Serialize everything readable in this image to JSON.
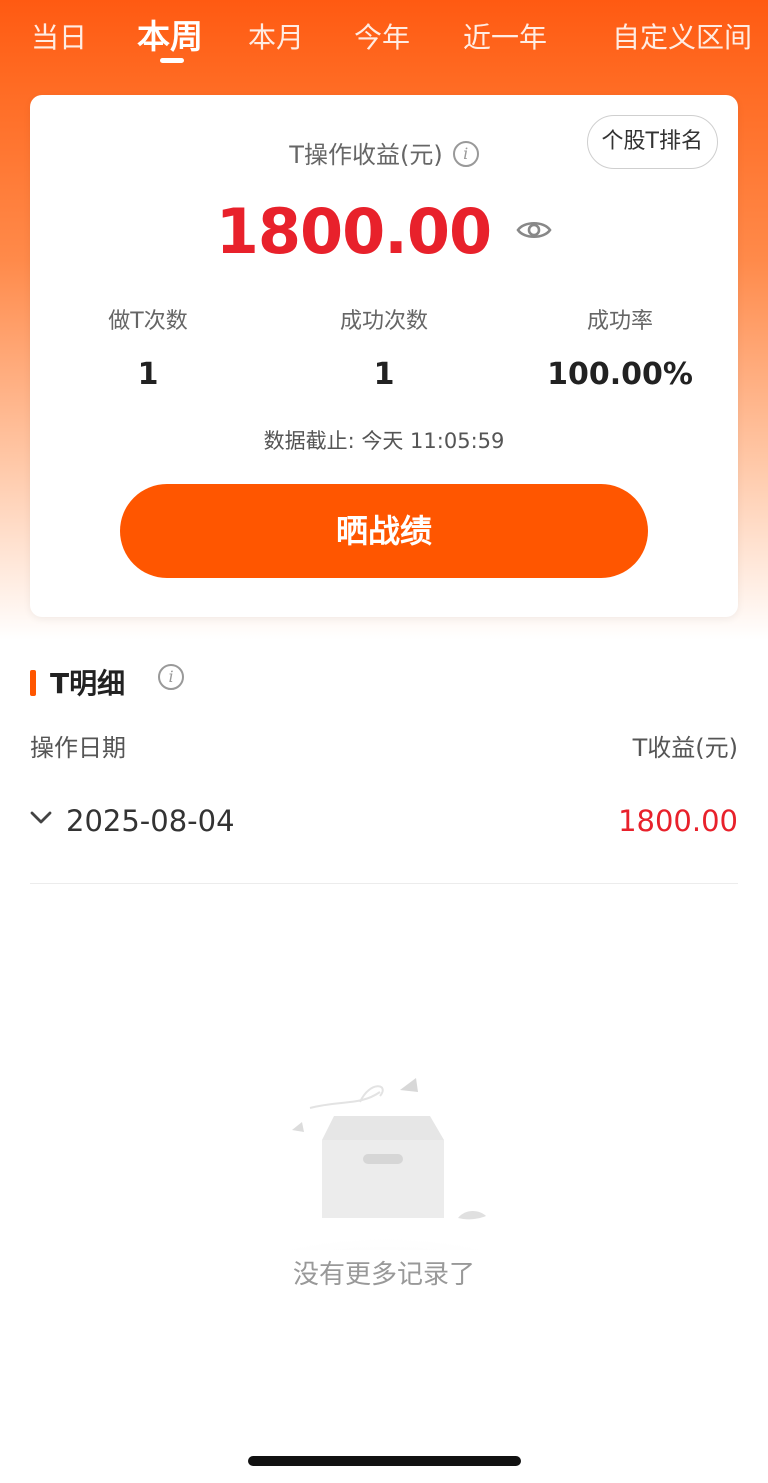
{
  "tabs": [
    {
      "label": "当日"
    },
    {
      "label": "本周"
    },
    {
      "label": "本月"
    },
    {
      "label": "今年"
    },
    {
      "label": "近一年"
    },
    {
      "label": "自定义区间"
    }
  ],
  "active_tab": "本周",
  "summary": {
    "rank_button": "个股T排名",
    "profit_label": "T操作收益(元)",
    "profit_value": "1800.00",
    "stats": [
      {
        "label": "做T次数",
        "value": "1"
      },
      {
        "label": "成功次数",
        "value": "1"
      },
      {
        "label": "成功率",
        "value": "100.00%"
      }
    ],
    "updated": "数据截止: 今天 11:05:59",
    "share_button": "晒战绩"
  },
  "details": {
    "title": "T明细",
    "col_date": "操作日期",
    "col_profit": "T收益(元)",
    "rows": [
      {
        "date": "2025-08-04",
        "profit": "1800.00"
      }
    ],
    "empty_text": "没有更多记录了"
  },
  "colors": {
    "accent": "#ff5600",
    "profit_red": "#e8212b"
  },
  "icons": [
    "info-icon",
    "eye-icon",
    "chevron-down-icon",
    "empty-box-illustration"
  ]
}
